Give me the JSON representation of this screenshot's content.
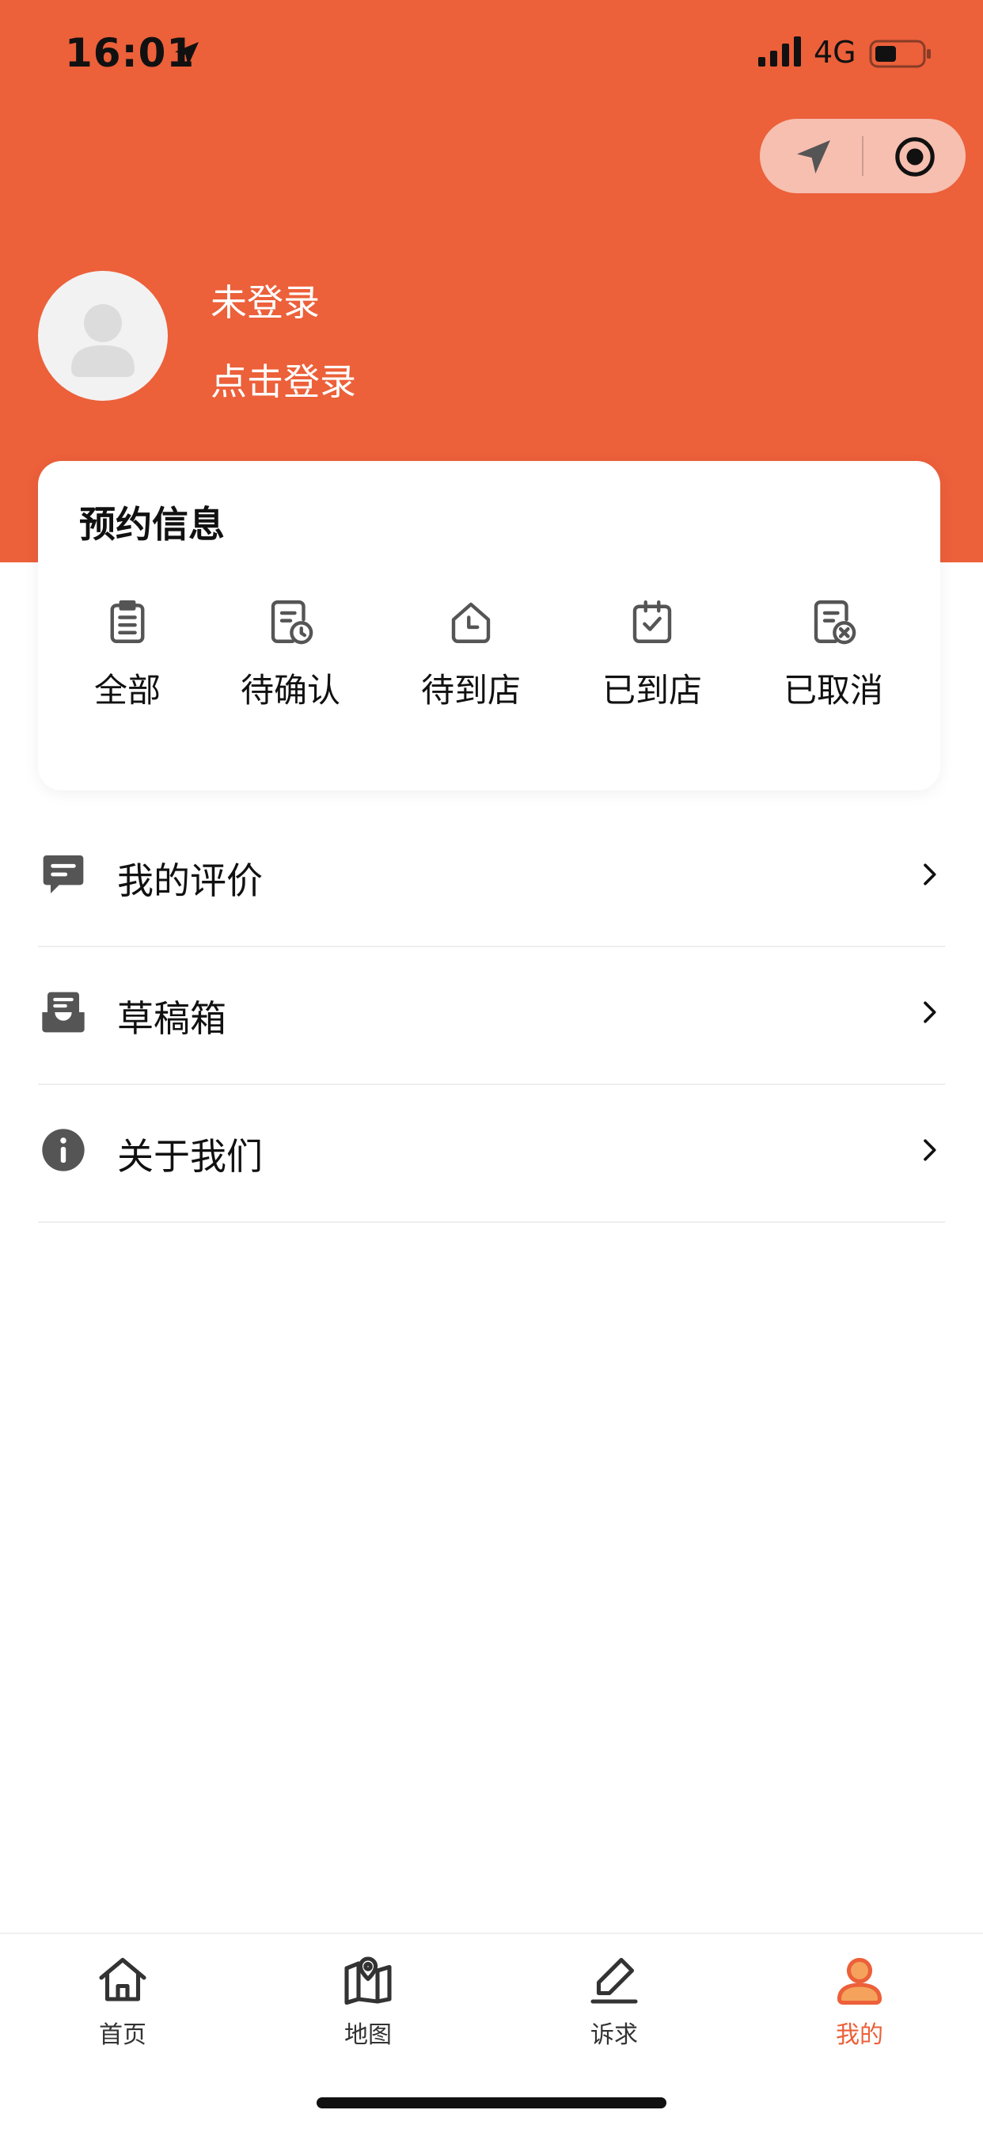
{
  "status_bar": {
    "time": "16:01",
    "network": "4G"
  },
  "colors": {
    "brand": "#EC603A",
    "text": "#111111",
    "icon_gray": "#555555"
  },
  "profile": {
    "status": "未登录",
    "login_link": "点击登录"
  },
  "reservation": {
    "title": "预约信息",
    "items": [
      {
        "label": "全部",
        "icon": "clipboard-list-icon"
      },
      {
        "label": "待确认",
        "icon": "document-clock-icon"
      },
      {
        "label": "待到店",
        "icon": "house-clock-icon"
      },
      {
        "label": "已到店",
        "icon": "calendar-check-icon"
      },
      {
        "label": "已取消",
        "icon": "document-cancel-icon"
      }
    ]
  },
  "menu": [
    {
      "label": "我的评价",
      "icon": "comment-icon"
    },
    {
      "label": "草稿箱",
      "icon": "inbox-icon"
    },
    {
      "label": "关于我们",
      "icon": "info-icon"
    }
  ],
  "tabbar": {
    "tabs": [
      {
        "label": "首页",
        "icon": "home-icon",
        "active": false
      },
      {
        "label": "地图",
        "icon": "map-icon",
        "active": false
      },
      {
        "label": "诉求",
        "icon": "edit-icon",
        "active": false
      },
      {
        "label": "我的",
        "icon": "user-icon",
        "active": true
      }
    ]
  }
}
